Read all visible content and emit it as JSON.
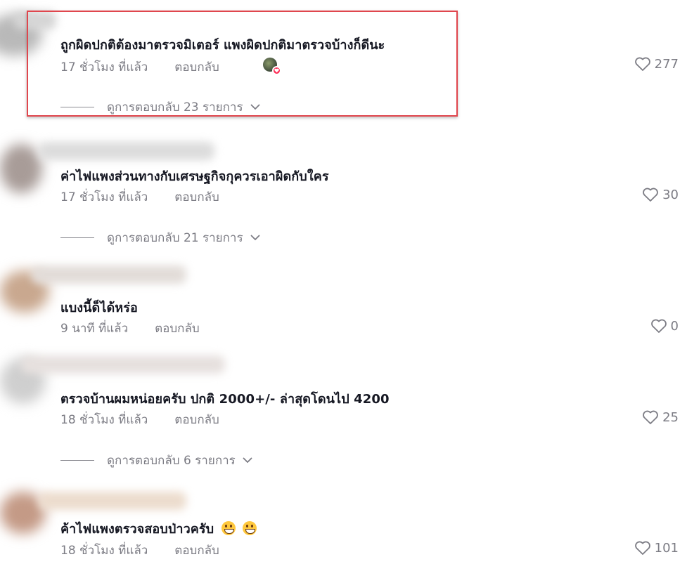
{
  "comments": [
    {
      "text": "ถูกผิดปกติต้องมาตรวจมิเตอร์ แพงผิดปกติมาตรวจบ้างก็ดีนะ",
      "time": "17 ชั่วโมง ที่แล้ว",
      "reply_label": "ตอบกลับ",
      "likes": "277",
      "view_replies": "ดูการตอบกลับ 23 รายการ",
      "creator_liked": true
    },
    {
      "text": "ค่าไฟแพงส่วนทางกับเศรษฐกิจกุควรเอาผิดกับใคร",
      "time": "17 ชั่วโมง ที่แล้ว",
      "reply_label": "ตอบกลับ",
      "likes": "30",
      "view_replies": "ดูการตอบกลับ 21 รายการ"
    },
    {
      "text": "แบงนี้ด็ได้หร่อ",
      "time": "9 นาที ที่แล้ว",
      "reply_label": "ตอบกลับ",
      "likes": "0"
    },
    {
      "text": "ตรวจบ้านผมหน่อยครับ ปกติ 2000+/- ล่าสุดโดนไป 4200",
      "time": "18 ชั่วโมง ที่แล้ว",
      "reply_label": "ตอบกลับ",
      "likes": "25",
      "view_replies": "ดูการตอบกลับ 6 รายการ"
    },
    {
      "text": "ค้าไฟแพงตรวจสอบป่าวครับ",
      "time": "18 ชั่วโมง ที่แล้ว",
      "reply_label": "ตอบกลับ",
      "likes": "101"
    }
  ],
  "icons": {
    "like": "heart-outline-icon",
    "expand": "chevron-down-icon",
    "emoji": "grinning-face-icon"
  },
  "colors": {
    "text": "#161823",
    "meta": "#7c7c84",
    "highlight": "#e0464d",
    "liked_heart": "#fe2c55"
  }
}
